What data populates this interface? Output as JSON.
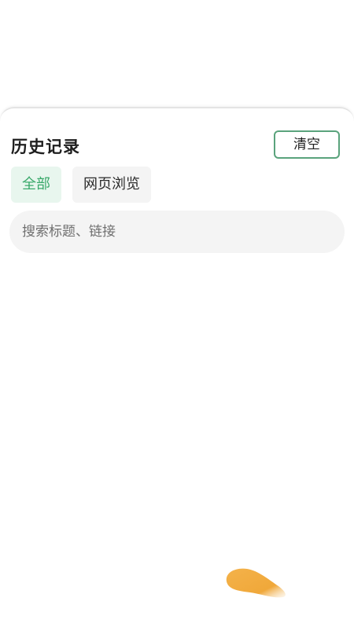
{
  "history": {
    "title": "历史记录",
    "clear_label": "清空",
    "tabs": [
      {
        "label": "全部",
        "selected": true
      },
      {
        "label": "网页浏览",
        "selected": false
      }
    ],
    "search": {
      "placeholder": "搜索标题、链接",
      "value": ""
    }
  },
  "colors": {
    "accent": "#3aa96b",
    "accent_bg": "#e8f6ee",
    "border_green": "#5aa37c",
    "blob": "#f0a83a"
  }
}
